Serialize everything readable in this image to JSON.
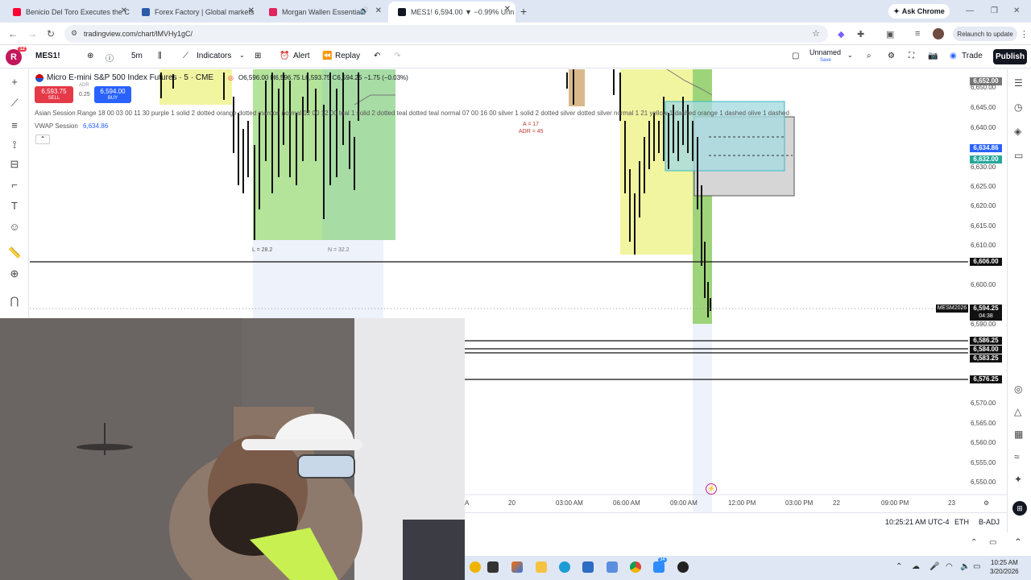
{
  "browser": {
    "tabs": [
      {
        "title": "Benicio Del Toro Executes the C",
        "icon_color": "#ff0033"
      },
      {
        "title": "Forex Factory | Global markets",
        "icon_color": "#2a5aa8"
      },
      {
        "title": "Morgan Wallen Essentials",
        "icon_color": "#e0245e"
      },
      {
        "title": "MES1! 6,594.00 ▼ −0.99% Unn",
        "icon_color": "#131722"
      }
    ],
    "new_tab": "+",
    "ask_chrome": "Ask Chrome",
    "url": "tradingview.com/chart/lMVHy1gC/",
    "relaunch": "Relaunch to update"
  },
  "toolbar": {
    "logo_letter": "R",
    "logo_badge": "12",
    "symbol": "MES1!",
    "interval": "5m",
    "indicators": "Indicators",
    "alert": "Alert",
    "replay": "Replay",
    "layout_name": "Unnamed",
    "layout_sub": "Save",
    "trade": "Trade",
    "publish": "Publish"
  },
  "legend": {
    "title": "Micro E-mini S&P 500 Index Futures · 5 · CME",
    "ohlc": "O6,596.00 H6,596.75 L6,593.75 C6,594.25 −1.75 (−0.03%)",
    "sell_price": "6,593.75",
    "sell_label": "SELL",
    "buy_price": "6,594.00",
    "buy_label": "BUY",
    "adr_label": "ADR",
    "spread": "0.25",
    "asian_session": "Asian Session Range  18 00 03 00 11 30 purple 1 solid 2 dotted orange dotted maroon normal 02 00 12 00 teal 1 solid 2 dotted teal dotted teal normal 07 00 16 00 silver 1 solid 2 dotted silver dotted silver normal 1 21 yellow 1 dashed orange 1 dashed olive 1 dashed",
    "vwap_label": "VWAP Session",
    "vwap_value": "6,634.86"
  },
  "annotations": {
    "a_label": "A = 17",
    "adr_label": "ADR = 45",
    "l_label": "L = 28.2",
    "n_label": "N = 32.2"
  },
  "price_axis": {
    "ticks": [
      "6,650.00",
      "6,645.00",
      "6,640.00",
      "6,630.00",
      "6,625.00",
      "6,620.00",
      "6,615.00",
      "6,610.00",
      "6,600.00",
      "6,590.00",
      "6,570.00",
      "6,565.00",
      "6,560.00",
      "6,555.00",
      "6,550.00"
    ],
    "top_box": "6,652.00",
    "vwap_box": "6,634.86",
    "green_box": "6,632.00",
    "line_6606": "6,606.00",
    "symbol_tag": "MESM2026",
    "last_price": "6,594.25",
    "countdown": "04:38",
    "line_6586": "6,586.25",
    "line_6584": "6,584.00",
    "line_6583": "6,583.25",
    "line_6576": "6,576.25"
  },
  "time_axis": [
    "20",
    "03:00 AM",
    "06:00 AM",
    "09:00 AM",
    "12:00 PM",
    "03:00 PM",
    "22",
    "09:00 PM",
    "23"
  ],
  "status_bar": {
    "clock": "10:25:21 AM UTC-4",
    "eth": "ETH",
    "badj": "B-ADJ"
  },
  "taskbar": {
    "time": "10:25 AM",
    "date": "3/20/2026",
    "badge": "34"
  },
  "colors": {
    "yellow_zone": "#f2f5a0",
    "green_zone": "#a8e08a",
    "blue_zone": "#e3eaf9",
    "sell": "#e53948",
    "buy": "#2962ff"
  }
}
